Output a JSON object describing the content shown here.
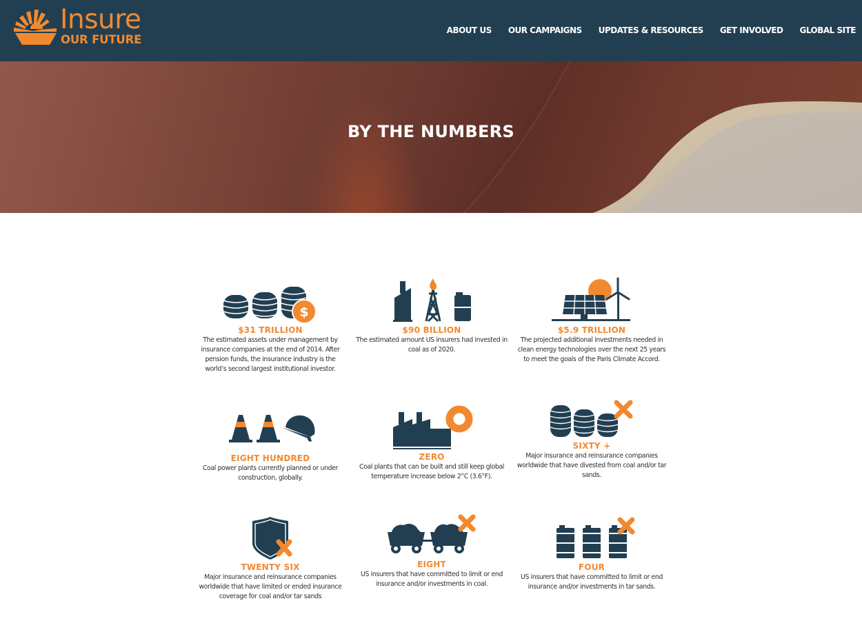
{
  "brand": {
    "name_line1": "Insure",
    "name_line2": "OUR FUTURE",
    "accent_color": "#f2892f",
    "navy_color": "#223f52"
  },
  "nav": {
    "items": [
      {
        "label": "ABOUT US"
      },
      {
        "label": "OUR CAMPAIGNS"
      },
      {
        "label": "UPDATES & RESOURCES"
      },
      {
        "label": "GET INVOLVED"
      },
      {
        "label": "GLOBAL SITE"
      }
    ]
  },
  "hero": {
    "title": "BY THE NUMBERS"
  },
  "stats": [
    {
      "icon": "coin-stacks-dollar-icon",
      "value": "$31 TRILLION",
      "description": "The estimated assets under management by insurance companies at the end of 2014. After pension funds, the insurance industry is the world’s second largest institutional investor."
    },
    {
      "icon": "fossil-fuel-icon",
      "value": "$90 BILLION",
      "description": "The estimated amount US insurers had invested in coal as of 2020."
    },
    {
      "icon": "solar-wind-icon",
      "value": "$5.9 TRILLION",
      "description": "The projected additional investments needed in clean energy technologies over the next 25 years to meet the goals of the Paris Climate Accord."
    },
    {
      "icon": "construction-cones-icon",
      "value": "EIGHT HUNDRED",
      "description": "Coal power plants currently planned or under construction, globally."
    },
    {
      "icon": "factory-zero-icon",
      "value": "ZERO",
      "description": "Coal plants that can be built and still keep global temperature increase below 2°C (3.6°F)."
    },
    {
      "icon": "divested-coins-icon",
      "value": "SIXTY +",
      "description": "Major insurance and reinsurance companies worldwide that have divested from coal and/or tar sands."
    },
    {
      "icon": "shield-x-icon",
      "value": "TWENTY SIX",
      "description": "Major insurance and reinsurance companies worldwide that have limited or ended insurance coverage for coal and/or tar sands"
    },
    {
      "icon": "coal-carts-x-icon",
      "value": "EIGHT",
      "description": "US insurers that have committed to limit or end insurance and/or investments in coal."
    },
    {
      "icon": "barrels-x-icon",
      "value": "FOUR",
      "description": "US insurers that have committed to limit or end insurance and/or investments in tar sands."
    }
  ]
}
